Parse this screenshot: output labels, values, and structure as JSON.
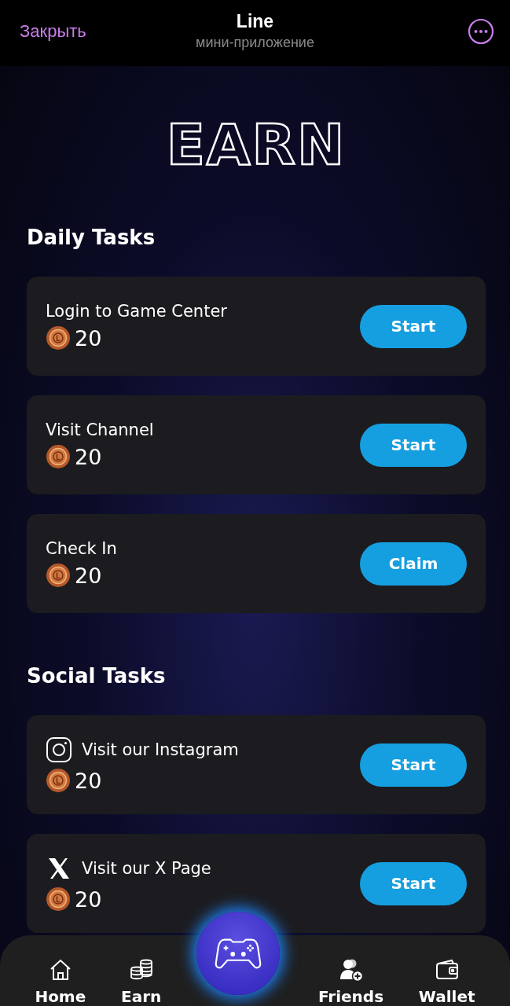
{
  "header": {
    "close": "Закрыть",
    "title": "Line",
    "subtitle": "мини-приложение"
  },
  "page_title": "EARN",
  "sections": [
    {
      "title": "Daily Tasks",
      "tasks": [
        {
          "kind": "plain",
          "label": "Login to Game Center",
          "reward": "20",
          "action": "Start"
        },
        {
          "kind": "plain",
          "label": "Visit Channel",
          "reward": "20",
          "action": "Start"
        },
        {
          "kind": "plain",
          "label": "Check In",
          "reward": "20",
          "action": "Claim"
        }
      ]
    },
    {
      "title": "Social Tasks",
      "tasks": [
        {
          "kind": "instagram",
          "label": "Visit our Instagram",
          "reward": "20",
          "action": "Start"
        },
        {
          "kind": "x",
          "label": "Visit our X Page",
          "reward": "20",
          "action": "Start"
        }
      ]
    }
  ],
  "nav": [
    {
      "kind": "home",
      "label": "Home"
    },
    {
      "kind": "earn",
      "label": "Earn"
    },
    {
      "kind": "game"
    },
    {
      "kind": "friends",
      "label": "Friends"
    },
    {
      "kind": "wallet",
      "label": "Wallet"
    }
  ]
}
